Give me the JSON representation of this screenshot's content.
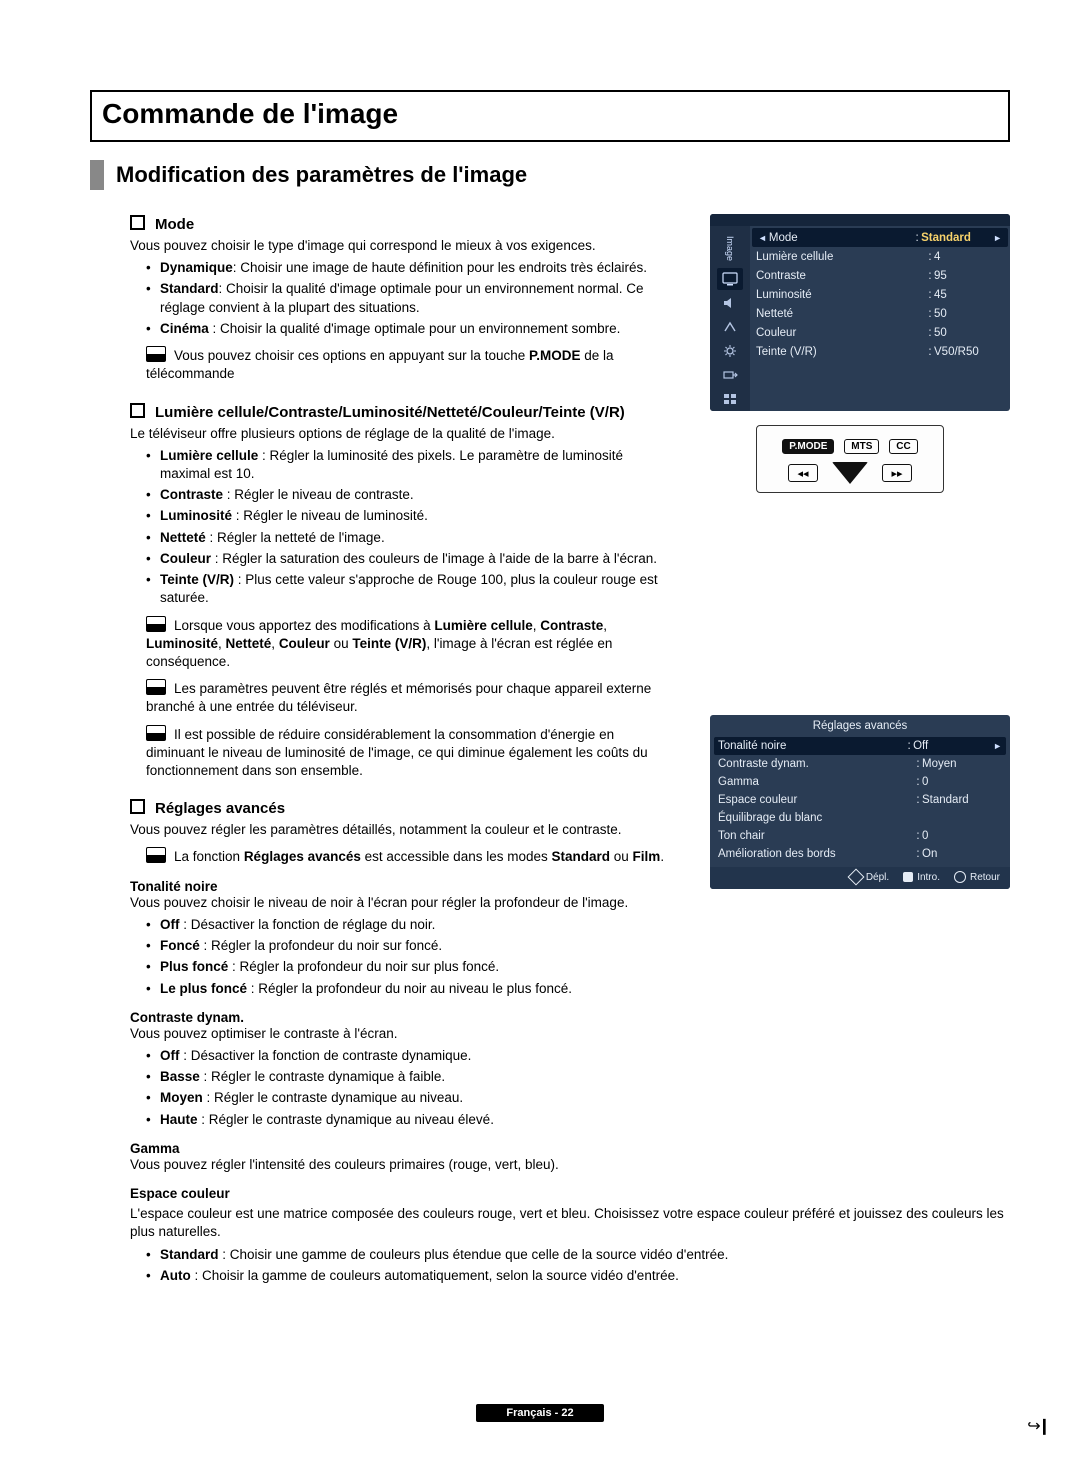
{
  "title": "Commande de l'image",
  "subtitle": "Modification des paramètres de l'image",
  "footer": "Français - 22",
  "pageflip": "↪❙",
  "s_mode": {
    "head": "Mode",
    "intro": "Vous pouvez choisir le type d'image qui correspond le mieux à vos exigences.",
    "dyn_b": "Dynamique",
    "dyn_t": ": Choisir une image de haute définition pour les endroits très éclairés.",
    "std_b": "Standard",
    "std_t": ": Choisir la qualité d'image optimale pour un environnement normal. Ce réglage convient à la plupart des situations.",
    "cin_b": "Cinéma",
    "cin_t": " : Choisir la qualité d'image optimale pour un environnement sombre.",
    "note_a": "Vous pouvez choisir ces options en appuyant sur la touche ",
    "note_b": "P.MODE",
    "note_c": " de la télécommande"
  },
  "s_params": {
    "head": "Lumière cellule/Contraste/Luminosité/Netteté/Couleur/Teinte (V/R)",
    "intro": "Le téléviseur offre plusieurs options de réglage de la qualité de l'image.",
    "lum_b": "Lumière cellule",
    "lum_t": " : Régler la luminosité des pixels. Le paramètre de luminosité maximal est 10.",
    "con_b": "Contraste",
    "con_t": " : Régler le niveau de contraste.",
    "lumi_b": "Luminosité",
    "lumi_t": " : Régler le niveau de luminosité.",
    "net_b": "Netteté",
    "net_t": " : Régler la netteté de l'image.",
    "col_b": "Couleur",
    "col_t": " : Régler la saturation des couleurs de l'image à l'aide de la barre à l'écran.",
    "tvr_b": "Teinte (V/R)",
    "tvr_t": " : Plus cette valeur s'approche de Rouge 100, plus la couleur rouge est saturée.",
    "note1a": "Lorsque vous apportez des modifications à ",
    "note1b": "Lumière cellule",
    "note1c": ", ",
    "note1d": "Contraste",
    "note1e": ", ",
    "note1f": "Luminosité",
    "note1g": ", ",
    "note1h": "Netteté",
    "note1i": ", ",
    "note1j": "Couleur",
    "note1k": " ou ",
    "note1l": "Teinte (V/R)",
    "note1m": ", l'image à l'écran est réglée en conséquence.",
    "note2": "Les paramètres peuvent être réglés et mémorisés pour chaque appareil externe branché à une entrée du téléviseur.",
    "note3": "Il est possible de réduire considérablement la consommation d'énergie en diminuant le niveau de luminosité de l'image, ce qui diminue également les coûts du fonctionnement dans son ensemble."
  },
  "s_adv": {
    "head": "Réglages avancés",
    "intro": "Vous pouvez régler les paramètres détaillés, notamment la couleur et le contraste.",
    "note_a": "La fonction ",
    "note_b": "Réglages avancés",
    "note_c": " est accessible dans les modes ",
    "note_d": "Standard",
    "note_e": " ou ",
    "note_f": "Film",
    "note_g": ".",
    "ton_h": "Tonalité noire",
    "ton_i": "Vous pouvez choisir le niveau de noir à l'écran pour régler la profondeur de l'image.",
    "ton_off_b": "Off",
    "ton_off_t": " : Désactiver la fonction de réglage du noir.",
    "ton_f_b": "Foncé",
    "ton_f_t": " : Régler la profondeur du noir sur foncé.",
    "ton_pf_b": "Plus foncé",
    "ton_pf_t": " : Régler la profondeur du noir sur plus foncé.",
    "ton_lpf_b": "Le plus foncé",
    "ton_lpf_t": " : Régler la profondeur du noir au niveau le plus foncé.",
    "cd_h": "Contraste dynam.",
    "cd_i": "Vous pouvez optimiser le contraste à l'écran.",
    "cd_off_b": "Off",
    "cd_off_t": " : Désactiver la fonction de contraste dynamique.",
    "cd_b_b": "Basse",
    "cd_b_t": " : Régler le contraste dynamique à faible.",
    "cd_m_b": "Moyen",
    "cd_m_t": " : Régler le contraste dynamique au niveau.",
    "cd_h_b": "Haute",
    "cd_h_t": " : Régler le contraste dynamique au niveau élevé.",
    "ga_h": "Gamma",
    "ga_i": "Vous pouvez régler l'intensité des couleurs primaires (rouge, vert, bleu).",
    "ec_h": "Espace couleur",
    "ec_i": "L'espace couleur est une matrice composée des couleurs rouge, vert et bleu. Choisissez votre espace couleur préféré et jouissez des couleurs les plus naturelles.",
    "ec_s_b": "Standard",
    "ec_s_t": " : Choisir une gamme de couleurs plus étendue que celle de la source vidéo d'entrée.",
    "ec_a_b": "Auto",
    "ec_a_t": " : Choisir la gamme de couleurs automatiquement, selon la source vidéo d'entrée."
  },
  "osd1": {
    "tab_label": "Image",
    "rows": [
      {
        "k": "Mode",
        "v": "Standard",
        "hi": true
      },
      {
        "k": "Lumière cellule",
        "v": "4"
      },
      {
        "k": "Contraste",
        "v": "95"
      },
      {
        "k": "Luminosité",
        "v": "45"
      },
      {
        "k": "Netteté",
        "v": "50"
      },
      {
        "k": "Couleur",
        "v": "50"
      },
      {
        "k": "Teinte (V/R)",
        "v": "V50/R50"
      }
    ]
  },
  "remote": {
    "pmode": "P.MODE",
    "mts": "MTS",
    "cc": "CC",
    "rew": "◂◂",
    "ff": "▸▸"
  },
  "osd2": {
    "title": "Réglages avancés",
    "rows": [
      {
        "k": "Tonalité noire",
        "v": "Off",
        "hi": true
      },
      {
        "k": "Contraste dynam.",
        "v": "Moyen"
      },
      {
        "k": "Gamma",
        "v": "0"
      },
      {
        "k": "Espace couleur",
        "v": "Standard"
      },
      {
        "k": "Équilibrage du blanc",
        "v": ""
      },
      {
        "k": "Ton chair",
        "v": "0"
      },
      {
        "k": "Amélioration des bords",
        "v": "On"
      }
    ],
    "foot": {
      "move": "Dépl.",
      "enter": "Intro.",
      "ret": "Retour"
    }
  }
}
